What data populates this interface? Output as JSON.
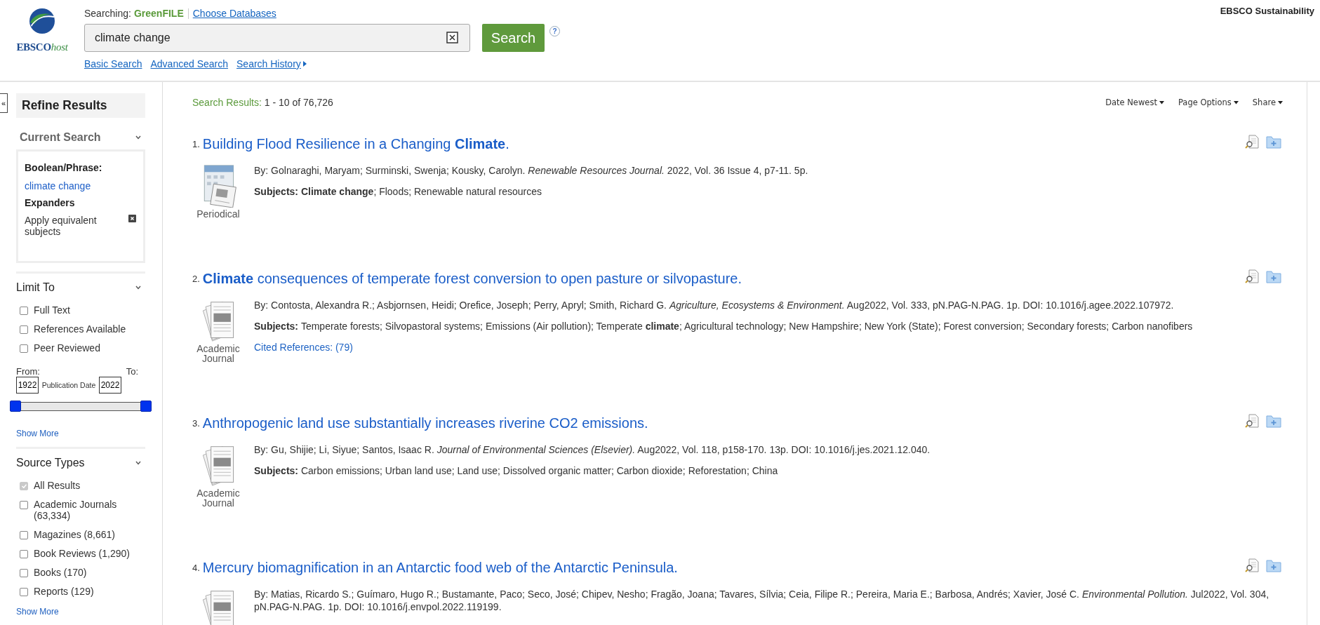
{
  "header": {
    "logo": {
      "main": "EBSCO",
      "suffix": "host"
    },
    "searching_label": "Searching:",
    "database": "GreenFILE",
    "choose_link": "Choose Databases",
    "search": {
      "value": "climate change"
    },
    "search_button": "Search",
    "help": "?",
    "links": [
      {
        "label": "Basic Search",
        "arrow": false
      },
      {
        "label": "Advanced Search",
        "arrow": false
      },
      {
        "label": "Search History",
        "arrow": true
      }
    ],
    "site_title": "EBSCO Sustainability"
  },
  "sidebar": {
    "collapse": "«",
    "title": "Refine Results",
    "current_search": {
      "title": "Current Search",
      "expanded": true,
      "boolean_label": "Boolean/Phrase:",
      "query": "climate change",
      "expanders_label": "Expanders",
      "expander": "Apply equivalent subjects"
    },
    "limit_to": {
      "title": "Limit To",
      "expanded": true,
      "options": [
        {
          "label": "Full Text",
          "checked": false
        },
        {
          "label": "References Available",
          "checked": false
        },
        {
          "label": "Peer Reviewed",
          "checked": false
        }
      ],
      "from_label": "From:",
      "to_label": "To:",
      "from_value": "1922",
      "to_value": "2022",
      "date_label": "Publication Date",
      "slider": {
        "thumbs": [
          {
            "level": 0
          },
          {
            "level": 1
          }
        ]
      },
      "show_more": "Show More"
    },
    "source_types": {
      "title": "Source Types",
      "expanded": true,
      "options": [
        {
          "label": "All Results",
          "checked": true,
          "disabled": true
        },
        {
          "label": "Academic Journals (63,334)",
          "checked": false,
          "disabled": false
        },
        {
          "label": "Magazines (8,661)",
          "checked": false,
          "disabled": false
        },
        {
          "label": "Book Reviews (1,290)",
          "checked": false,
          "disabled": false
        },
        {
          "label": "Books (170)",
          "checked": false,
          "disabled": false
        },
        {
          "label": "Reports (129)",
          "checked": false,
          "disabled": false
        }
      ],
      "show_more": "Show More"
    }
  },
  "results": {
    "count_label": "Search Results:",
    "count": "1 - 10 of 76,726",
    "tools": [
      "Date Newest",
      "Page Options",
      "Share"
    ],
    "items": [
      {
        "number": "1.",
        "title": "Building Flood Resilience in a Changing **Climate**.",
        "type": {
          "kind": "periodical",
          "label": "Periodical"
        },
        "byline": "By: Golnaraghi, Maryam; Surminski, Swenja; Kousky, Carolyn. *Renewable Resources Journal.* 2022, Vol. 36 Issue 4, p7-11. 5p.",
        "subjects_label": "Subjects:",
        "subjects": "**Climate change**; Floods; Renewable natural resources"
      },
      {
        "number": "2.",
        "title": "**Climate** consequences of temperate forest conversion to open pasture or silvopasture.",
        "type": {
          "kind": "journal",
          "label": "Academic Journal"
        },
        "byline": "By: Contosta, Alexandra R.; Asbjornsen, Heidi; Orefice, Joseph; Perry, Apryl; Smith, Richard G. *Agriculture, Ecosystems & Environment.* Aug2022, Vol. 333, pN.PAG-N.PAG. 1p. DOI: 10.1016/j.agee.2022.107972.",
        "subjects_label": "Subjects:",
        "subjects": "Temperate forests; Silvopastoral systems; Emissions (Air pollution); Temperate **climate**; Agricultural technology; New Hampshire; New York (State); Forest conversion; Secondary forests; Carbon nanofibers",
        "cited": "Cited References: (79)"
      },
      {
        "number": "3.",
        "title": "Anthropogenic land use substantially increases riverine CO2 emissions.",
        "type": {
          "kind": "journal",
          "label": "Academic Journal"
        },
        "byline": "By: Gu, Shijie; Li, Siyue; Santos, Isaac R. *Journal of Environmental Sciences (Elsevier).* Aug2022, Vol. 118, p158-170. 13p. DOI: 10.1016/j.jes.2021.12.040.",
        "subjects_label": "Subjects:",
        "subjects": "Carbon emissions; Urban land use; Land use; Dissolved organic matter; Carbon dioxide; Reforestation; China"
      },
      {
        "number": "4.",
        "title": "Mercury biomagnification in an Antarctic food web of the Antarctic Peninsula.",
        "type": {
          "kind": "journal"
        },
        "byline": "By: Matias, Ricardo S.; Guímaro, Hugo R.; Bustamante, Paco; Seco, José; Chipev, Nesho; Fragão, Joana; Tavares, Sílvia; Ceia, Filipe R.; Pereira, Maria E.; Barbosa, Andrés; Xavier, José C. *Environmental Pollution.* Jul2022, Vol. 304, pN.PAG-N.PAG. 1p. DOI: 10.1016/j.envpol.2022.119199."
      }
    ]
  }
}
